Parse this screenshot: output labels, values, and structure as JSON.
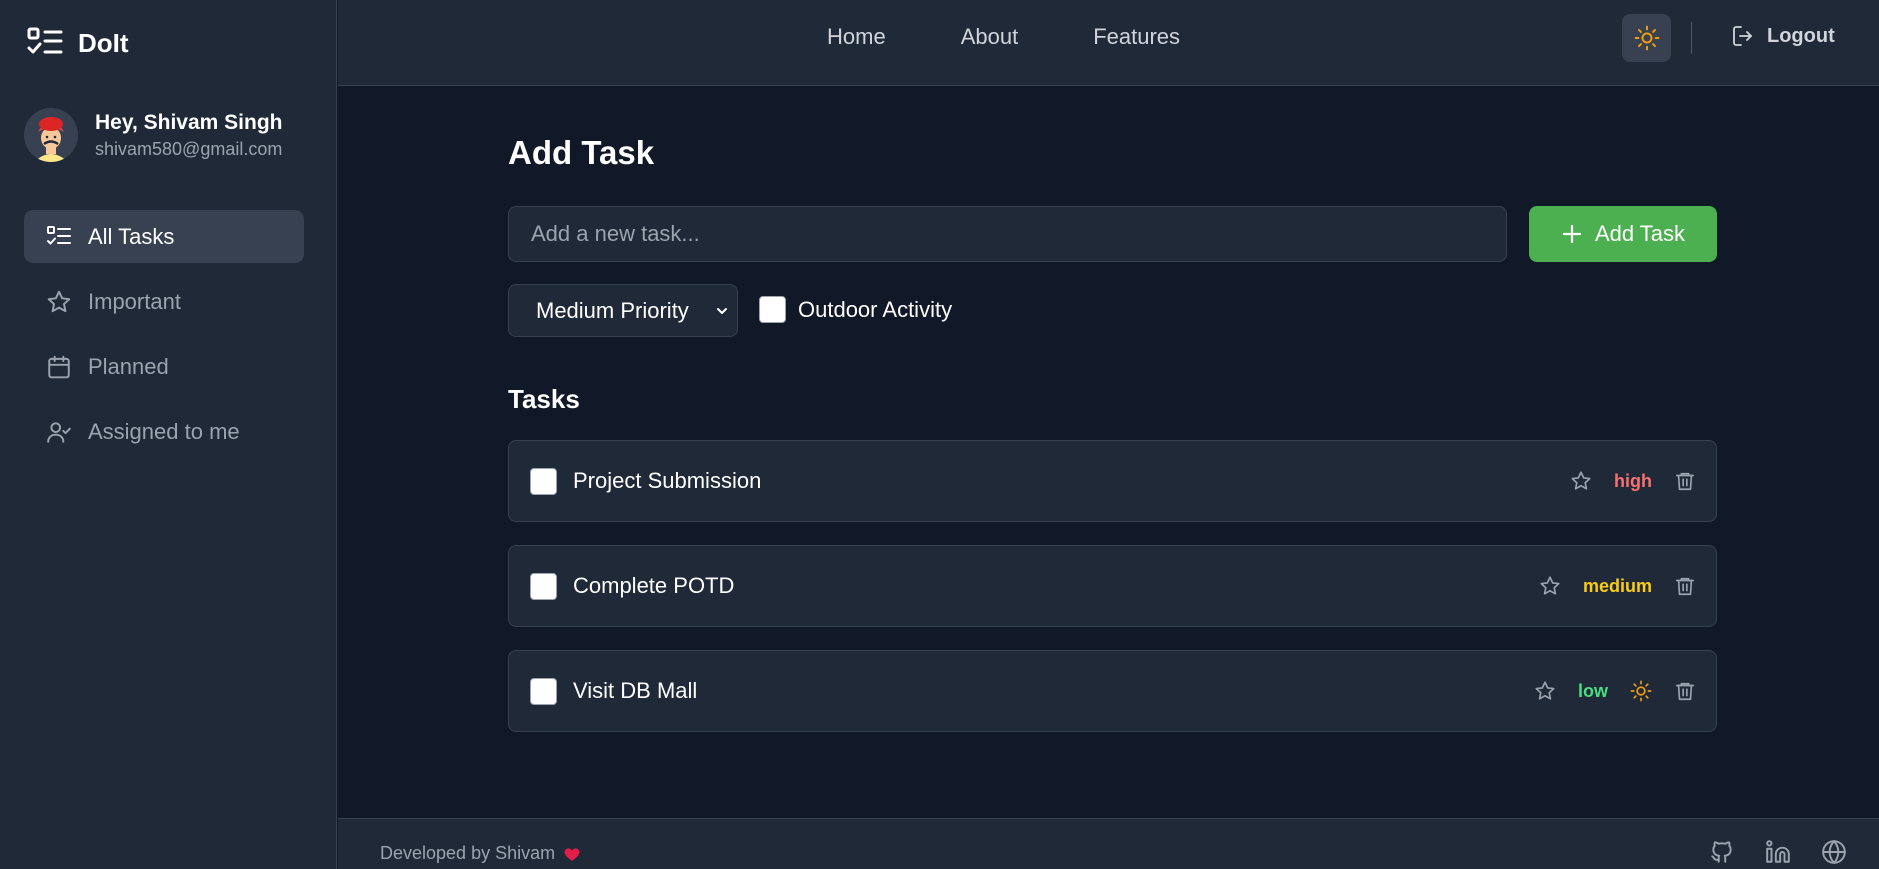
{
  "app": {
    "name": "DoIt"
  },
  "user": {
    "greeting": "Hey, Shivam Singh",
    "email": "shivam580@gmail.com"
  },
  "sidebar": {
    "items": [
      {
        "label": "All Tasks",
        "icon": "list-check-icon",
        "active": true
      },
      {
        "label": "Important",
        "icon": "star-icon",
        "active": false
      },
      {
        "label": "Planned",
        "icon": "calendar-icon",
        "active": false
      },
      {
        "label": "Assigned to me",
        "icon": "user-check-icon",
        "active": false
      }
    ]
  },
  "topnav": {
    "links": [
      "Home",
      "About",
      "Features"
    ],
    "theme_icon": "sun-icon",
    "logout_label": "Logout"
  },
  "add_task": {
    "heading": "Add Task",
    "input_placeholder": "Add a new task...",
    "input_value": "",
    "button_label": "Add Task",
    "priority_selected": "Medium Priority",
    "outdoor_label": "Outdoor Activity",
    "outdoor_checked": false
  },
  "tasks": {
    "heading": "Tasks",
    "items": [
      {
        "title": "Project Submission",
        "priority": "high",
        "priority_color": "#f87171",
        "outdoor": false,
        "done": false
      },
      {
        "title": "Complete POTD",
        "priority": "medium",
        "priority_color": "#facc15",
        "outdoor": false,
        "done": false
      },
      {
        "title": "Visit DB Mall",
        "priority": "low",
        "priority_color": "#4ade80",
        "outdoor": true,
        "done": false
      }
    ]
  },
  "footer": {
    "text": "Developed by Shivam",
    "icons": [
      "github-icon",
      "linkedin-icon",
      "globe-icon"
    ]
  },
  "colors": {
    "accent": "#4caf50",
    "heart": "#e11d48",
    "sun": "#f59e0b"
  }
}
